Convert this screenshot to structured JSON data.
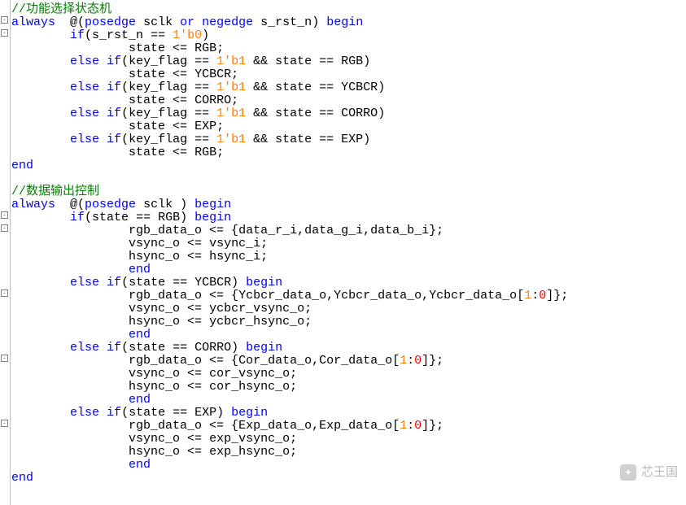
{
  "comments": {
    "block1": "//功能选择状态机",
    "block2": "//数据输出控制"
  },
  "kw": {
    "always": "always",
    "posedge": "posedge",
    "or": "or",
    "negedge": "negedge",
    "begin": "begin",
    "end": "end",
    "if": "if",
    "else": "else"
  },
  "lit": {
    "b0": "1'b0",
    "b1": "1'b1",
    "one": "1",
    "zero": "0"
  },
  "sig": {
    "sclk": "sclk",
    "s_rst_n": "s_rst_n",
    "state": "state",
    "key_flag": "key_flag",
    "RGB": "RGB",
    "YCBCR": "YCBCR",
    "CORRO": "CORRO",
    "EXP": "EXP",
    "rgb_data_o": "rgb_data_o",
    "vsync_o": "vsync_o",
    "hsync_o": "hsync_o",
    "vsync_i": "vsync_i",
    "hsync_i": "hsync_i",
    "data_r_i": "data_r_i",
    "data_g_i": "data_g_i",
    "data_b_i": "data_b_i",
    "Ycbcr_data_o": "Ycbcr_data_o",
    "ycbcr_vsync_o": "ycbcr_vsync_o",
    "ycbcr_hsync_o": "ycbcr_hsync_o",
    "Cor_data_o": "Cor_data_o",
    "cor_vsync_o": "cor_vsync_o",
    "cor_hsync_o": "cor_hsync_o",
    "Exp_data_o": "Exp_data_o",
    "exp_vsync_o": "exp_vsync_o",
    "exp_hsync_o": "exp_hsync_o"
  },
  "watermark": {
    "label": "芯王国"
  }
}
